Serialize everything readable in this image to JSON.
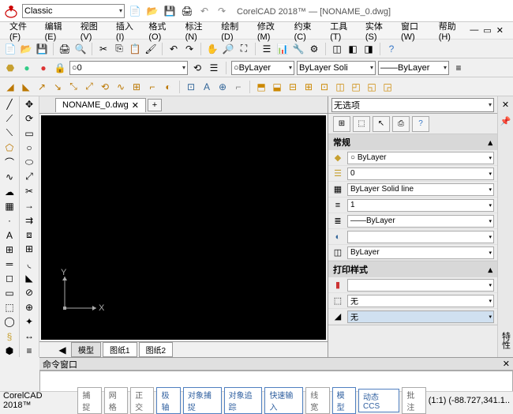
{
  "app": {
    "workspace": "Classic",
    "title_prefix": "CorelCAD 2018™ — ",
    "doc_name": "[NONAME_0.dwg]",
    "brand": "CorelCAD 2018™"
  },
  "menus": [
    "文件(F)",
    "编辑(E)",
    "视图(V)",
    "插入(I)",
    "格式(O)",
    "标注(N)",
    "绘制(D)",
    "修改(M)",
    "约束(C)",
    "工具(T)",
    "实体(S)",
    "窗口(W)",
    "帮助(H)"
  ],
  "tab": {
    "name": "NONAME_0.dwg"
  },
  "layer_combo": "0",
  "props": {
    "color": "ByLayer",
    "ltype": "ByLayer     Soli",
    "lweight": "——ByLayer"
  },
  "bottom_tabs": [
    "模型",
    "图纸1",
    "图纸2"
  ],
  "cmd_title": "命令窗口",
  "panel": {
    "noopt": "无选项",
    "sec1": "常规",
    "sec2": "打印样式",
    "rows": {
      "color": "○ ByLayer",
      "layer": "0",
      "ltype": "ByLayer    Solid line",
      "ltscale": "1",
      "lweight": "——ByLayer",
      "thickness": "",
      "bylayer2": "ByLayer",
      "pstyle1": "",
      "pstyle2": "无",
      "pstyle3": "无"
    }
  },
  "ucs": {
    "x": "X",
    "y": "Y"
  },
  "status": {
    "buttons": [
      "捕捉",
      "网格",
      "正交",
      "极轴",
      "对象捕捉",
      "对象追踪",
      "快速输入",
      "线宽",
      "模型",
      "动态 CCS",
      "批注"
    ],
    "ratio": "(1:1)",
    "coords": "(-88.727,341.1.."
  }
}
